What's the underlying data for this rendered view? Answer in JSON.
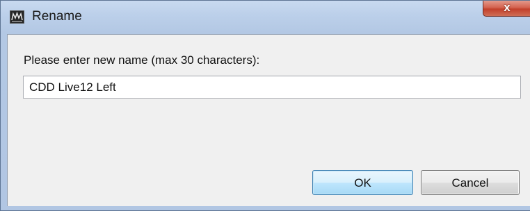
{
  "window": {
    "title": "Rename",
    "app_icon": "vu-meter-app-icon",
    "close_label": "x"
  },
  "dialog": {
    "prompt": "Please enter new name (max 30 characters):",
    "name_value": "CDD Live12 Left",
    "ok_label": "OK",
    "cancel_label": "Cancel"
  },
  "colors": {
    "frame": "#b3c8e4",
    "client": "#f0f0f0",
    "close_button": "#c9503c",
    "default_button_border": "#3c7fb1"
  }
}
